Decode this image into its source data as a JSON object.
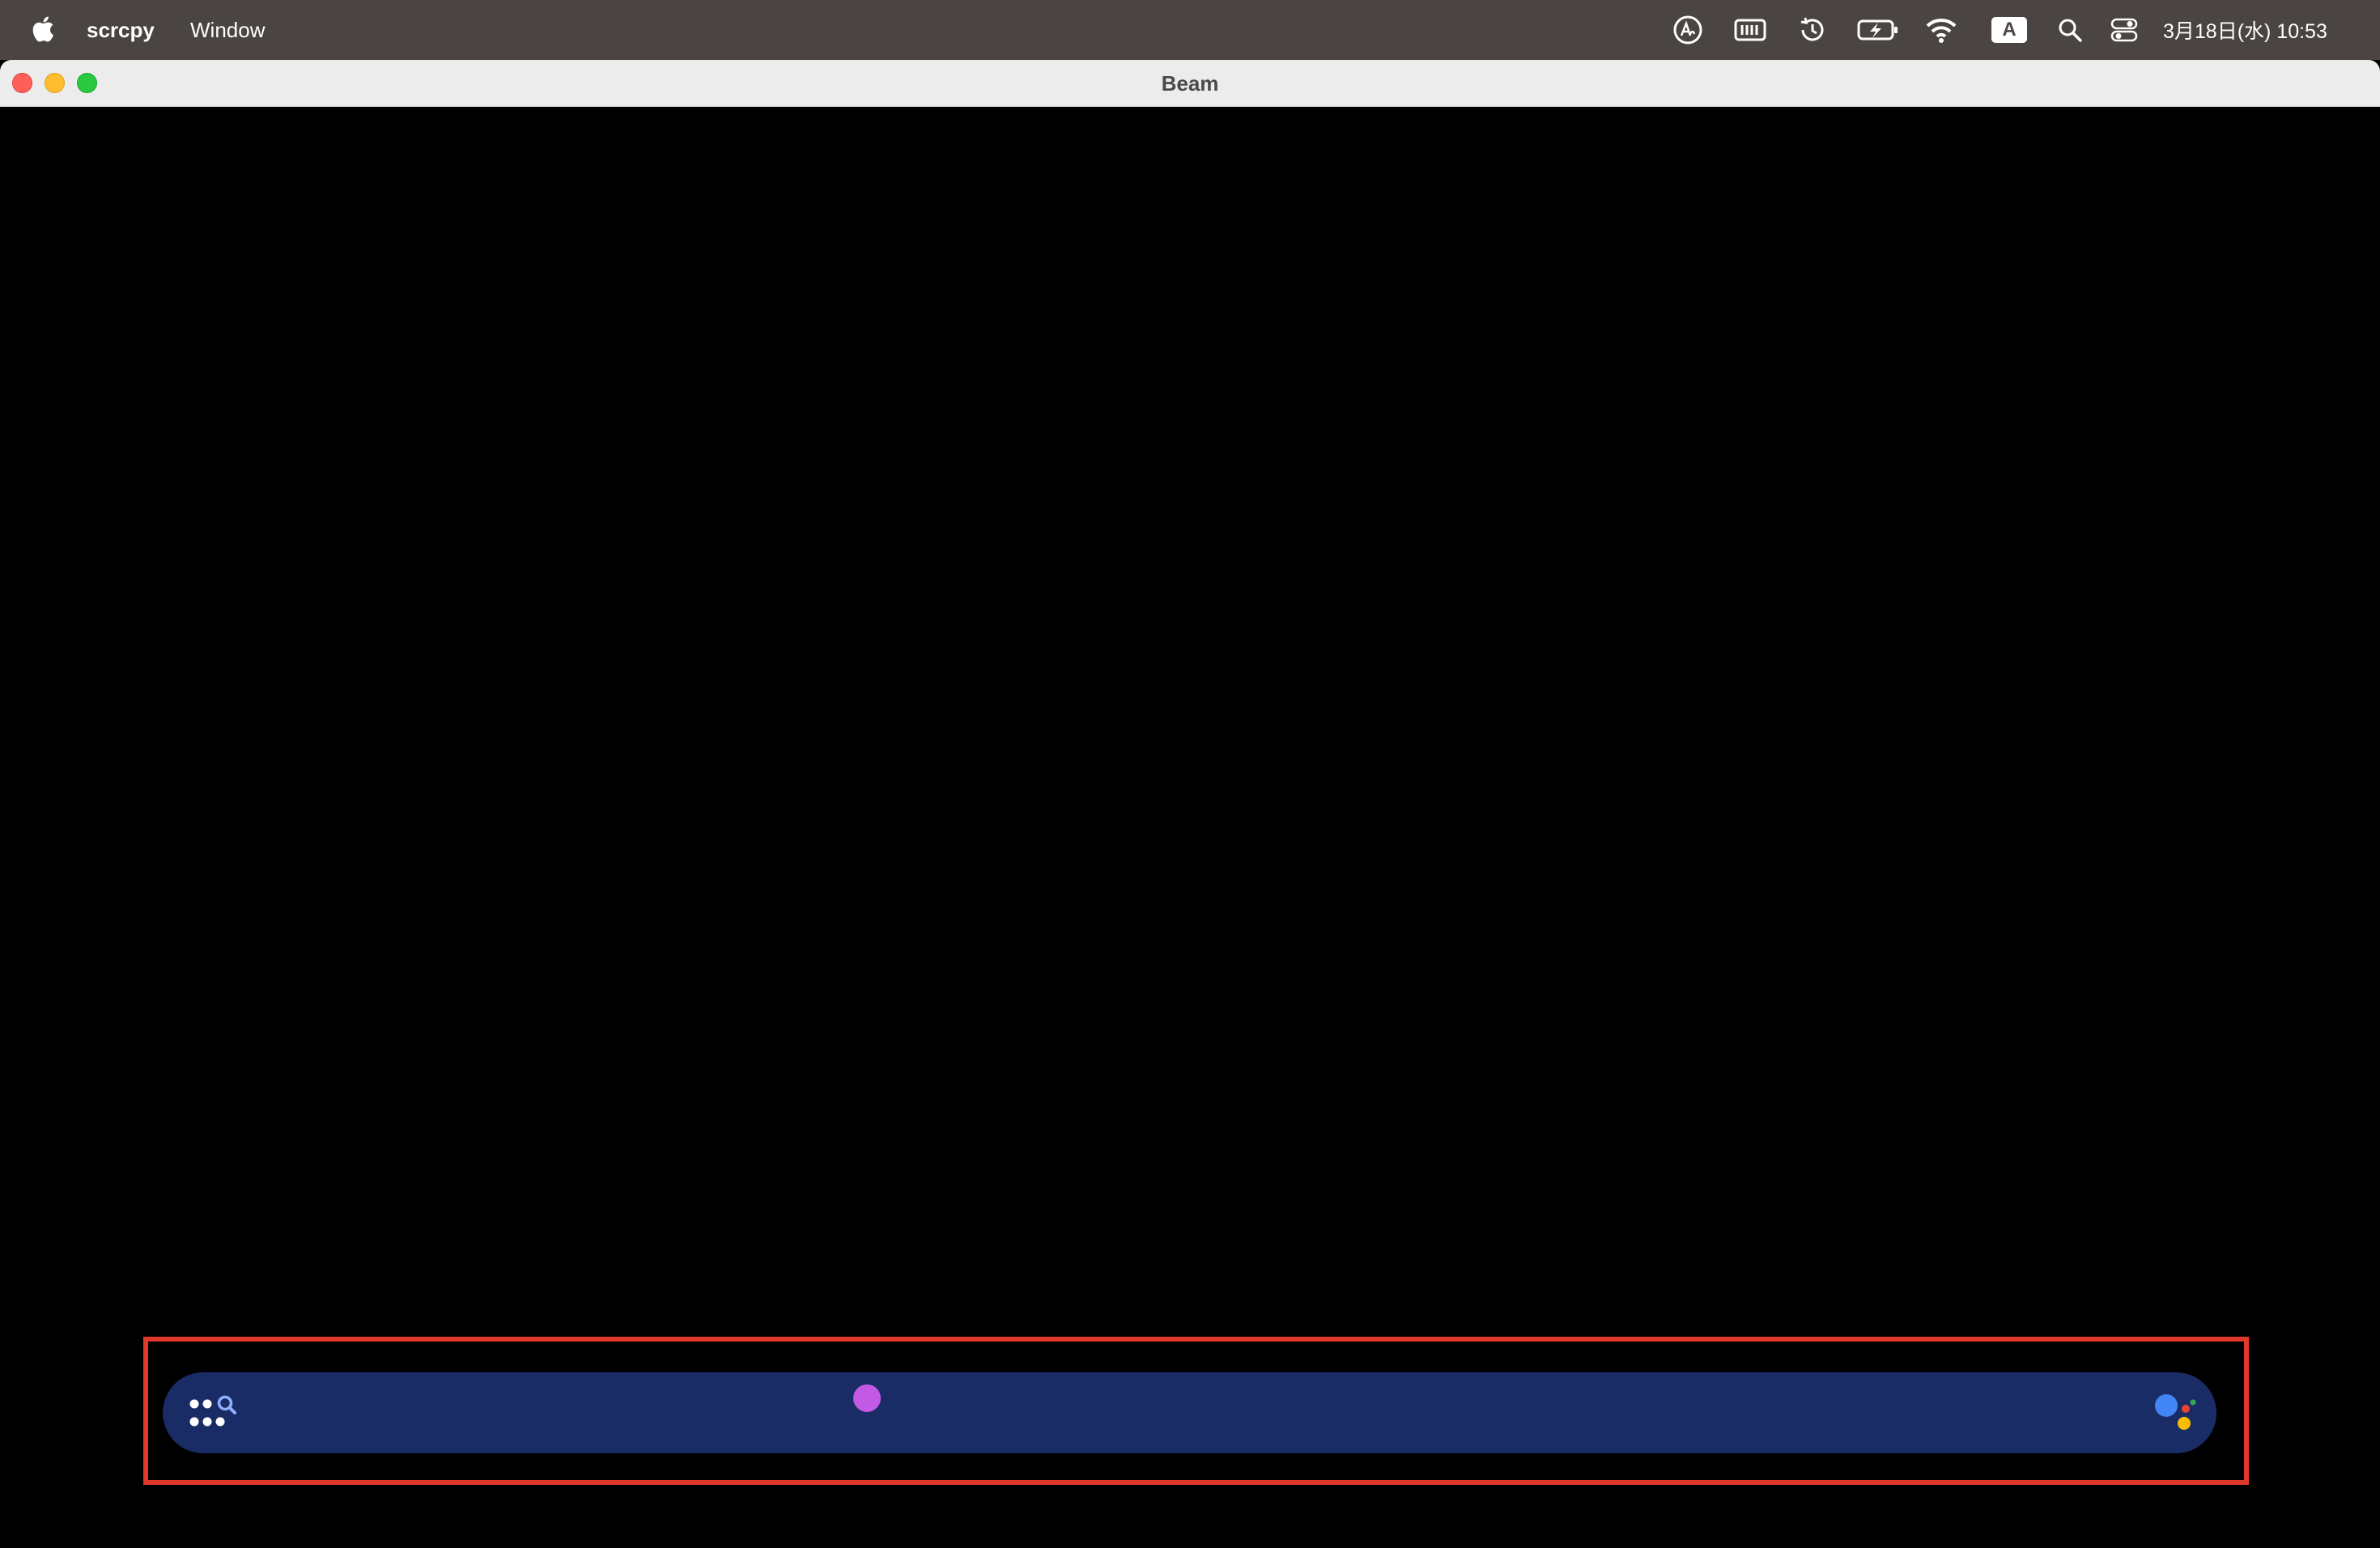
{
  "menubar": {
    "app_name": "scrcpy",
    "menus": [
      "Window"
    ],
    "input_mode_label": "A",
    "clock": "3月18日(水) 10:53",
    "status_icons": [
      "handwriting-icon",
      "keyboard-icon",
      "time-machine-icon",
      "battery-charging-icon",
      "wifi-icon",
      "input-mode-icon",
      "spotlight-search-icon",
      "control-center-icon"
    ]
  },
  "window": {
    "title": "Beam"
  },
  "device": {
    "search_bar": {
      "left_icon": "apps-search-icon",
      "right_icon": "google-assistant-icon"
    },
    "colors": {
      "search_bar": "#1a2c66",
      "touch_indicator": "#c25ae6",
      "highlight": "#e0382b"
    }
  }
}
